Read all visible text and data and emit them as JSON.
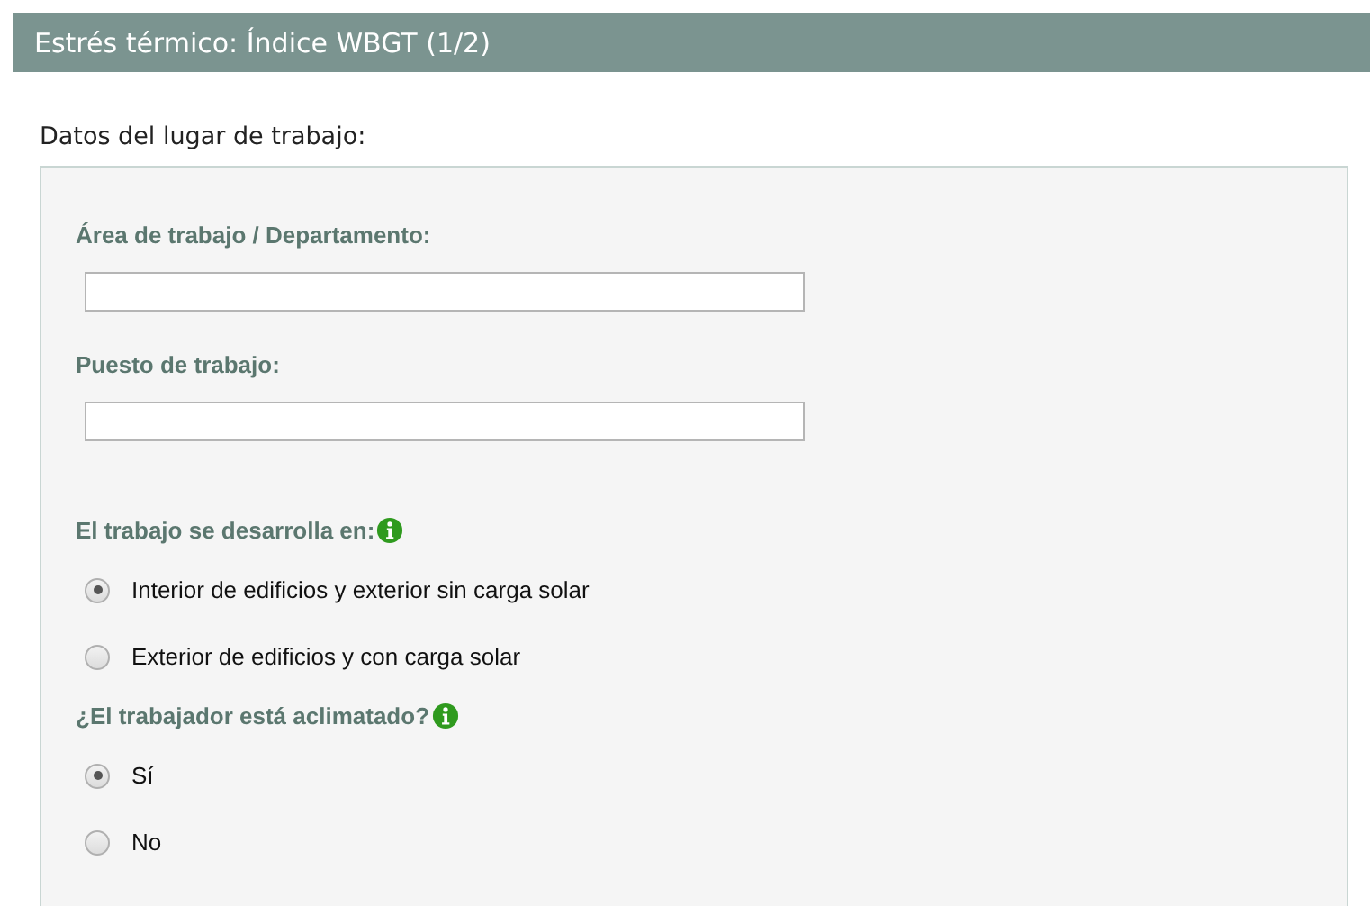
{
  "header": {
    "title": "Estrés térmico: Índice WBGT (1/2)"
  },
  "section_title": "Datos del lugar de trabajo:",
  "fields": [
    {
      "label": "Área de trabajo / Departamento:"
    },
    {
      "label": "Puesto de trabajo:"
    }
  ],
  "questions": [
    {
      "label": "El trabajo se desarrolla en:",
      "options": [
        {
          "label": "Interior de edificios y exterior sin carga solar",
          "selected": true
        },
        {
          "label": "Exterior de edificios y con carga solar",
          "selected": false
        }
      ]
    },
    {
      "label": "¿El trabajador está aclimatado?",
      "options": [
        {
          "label": "Sí",
          "selected": true
        },
        {
          "label": "No",
          "selected": false
        }
      ]
    }
  ]
}
